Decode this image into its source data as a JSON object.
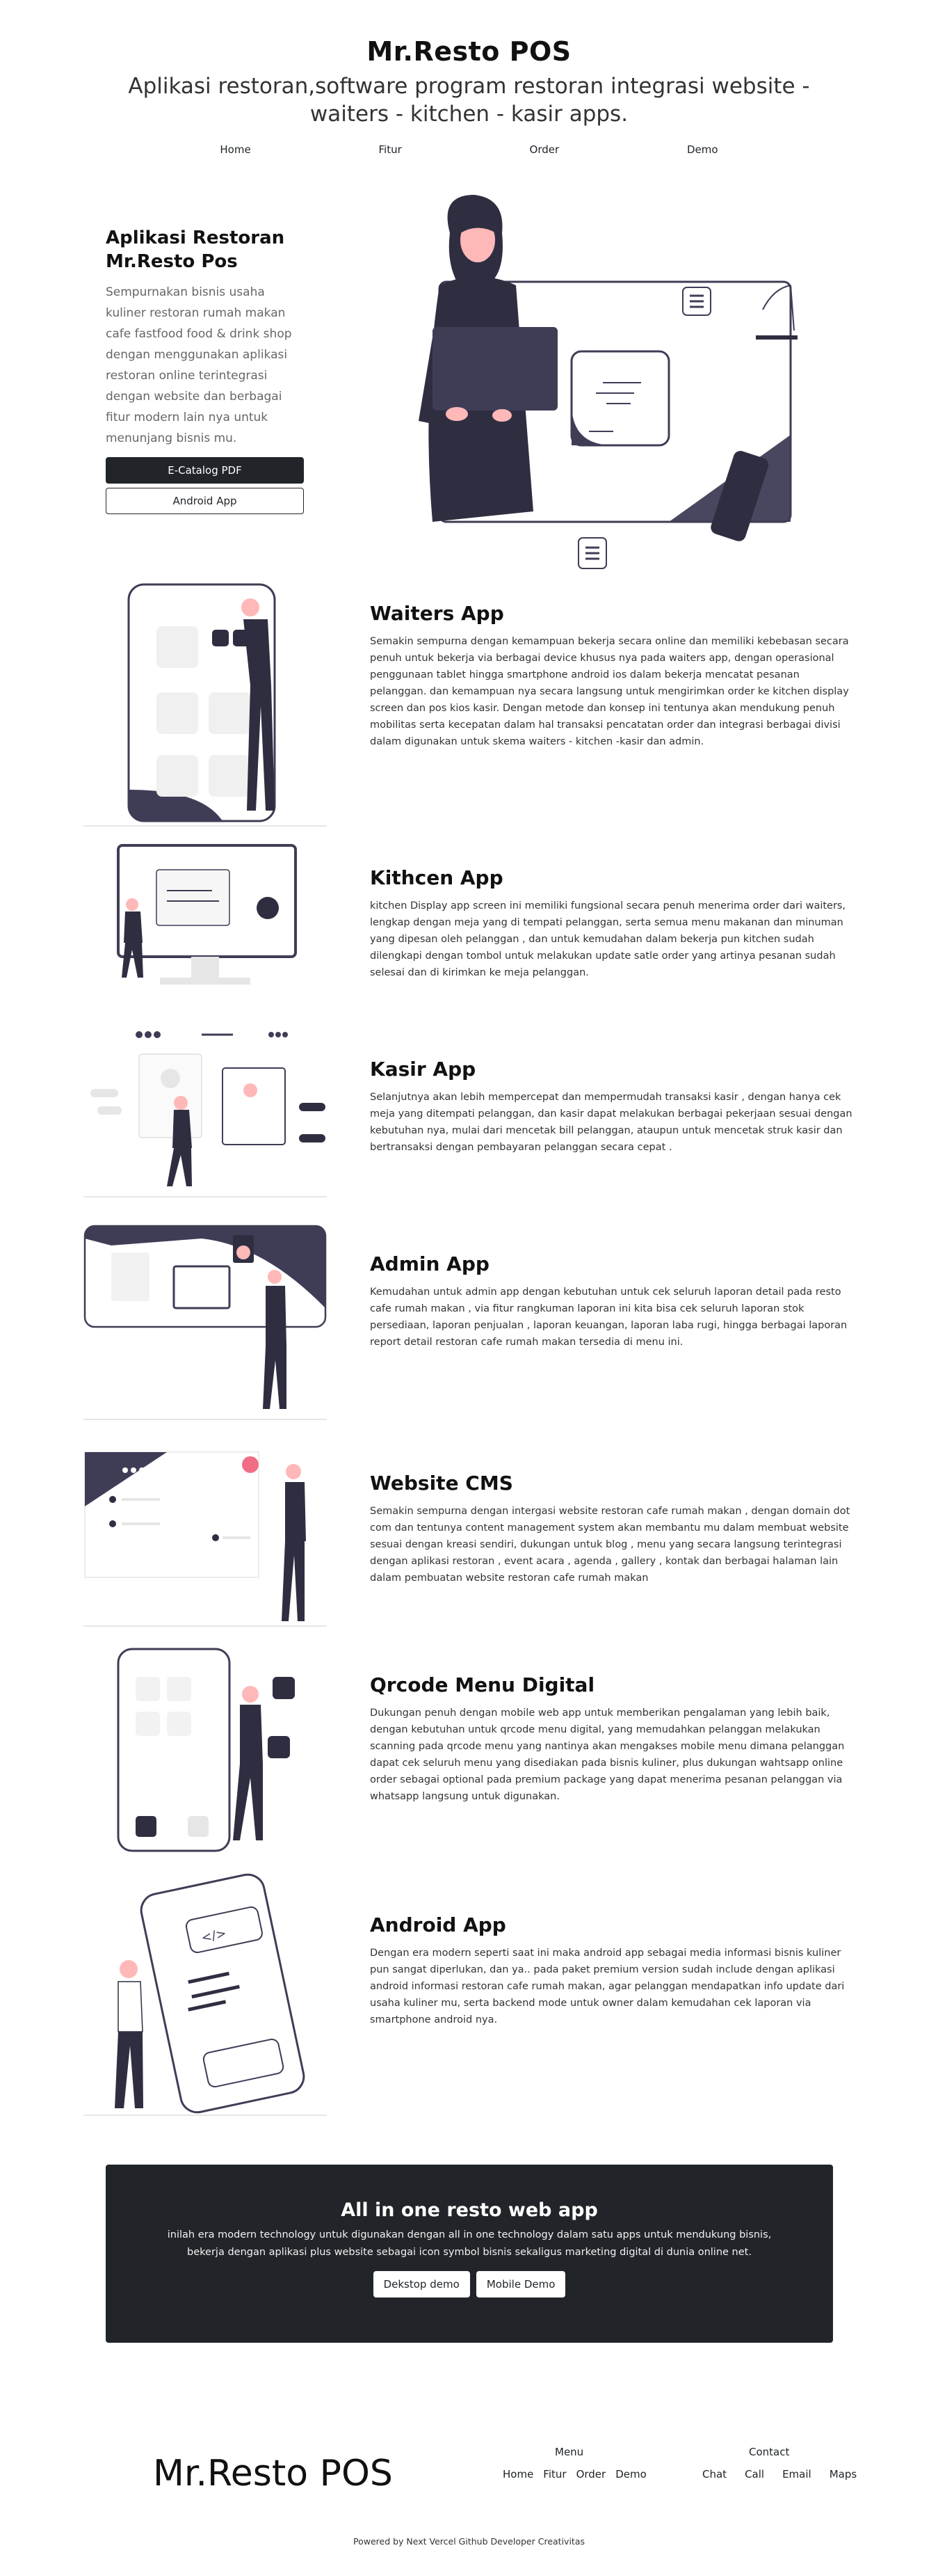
{
  "header": {
    "brand": "Mr.Resto POS",
    "subtitle": "Aplikasi restoran,software program restoran integrasi website - waiters - kitchen - kasir apps."
  },
  "nav": [
    "Home",
    "Fitur",
    "Order",
    "Demo"
  ],
  "hero": {
    "title": "Aplikasi Restoran Mr.Resto Pos",
    "description": "Sempurnakan bisnis usaha kuliner restoran rumah makan cafe fastfood food & drink shop dengan menggunakan aplikasi restoran online terintegrasi dengan website dan berbagai fitur modern lain nya untuk menunjang bisnis mu.",
    "catalog_button": "E-Catalog PDF",
    "android_button": "Android App"
  },
  "features": [
    {
      "title": "Waiters App",
      "text": "Semakin sempurna dengan kemampuan bekerja secara online dan memiliki kebebasan secara penuh untuk bekerja via berbagai device khusus nya pada waiters app, dengan operasional penggunaan tablet hingga smartphone android ios dalam bekerja mencatat pesanan pelanggan. dan kemampuan nya secara langsung untuk mengirimkan order ke kitchen display screen dan pos kios kasir. Dengan metode dan konsep ini tentunya akan mendukung penuh mobilitas serta kecepatan dalam hal transaksi pencatatan order dan integrasi berbagai divisi dalam digunakan untuk skema waiters - kitchen -kasir dan admin."
    },
    {
      "title": "Kithcen App",
      "text": "kitchen Display app screen ini memiliki fungsional secara penuh menerima order dari waiters, lengkap dengan meja yang di tempati pelanggan, serta semua menu makanan dan minuman yang dipesan oleh pelanggan , dan untuk kemudahan dalam bekerja pun kitchen sudah dilengkapi dengan tombol untuk melakukan update satle order yang artinya pesanan sudah selesai dan di kirimkan ke meja pelanggan."
    },
    {
      "title": "Kasir App",
      "text": "Selanjutnya akan lebih mempercepat dan mempermudah transaksi kasir , dengan hanya cek meja yang ditempati pelanggan, dan kasir dapat melakukan berbagai pekerjaan sesuai dengan kebutuhan nya, mulai dari mencetak bill pelanggan, ataupun untuk mencetak struk kasir dan bertransaksi dengan pembayaran pelanggan secara cepat ."
    },
    {
      "title": "Admin App",
      "text": "Kemudahan untuk admin app dengan kebutuhan untuk cek seluruh laporan detail pada resto cafe rumah makan , via fitur rangkuman laporan ini kita bisa cek seluruh laporan stok persediaan, laporan penjualan , laporan keuangan, laporan laba rugi, hingga berbagai laporan report detail restoran cafe rumah makan tersedia di menu ini."
    },
    {
      "title": "Website CMS",
      "text": "Semakin sempurna dengan intergasi website restoran cafe rumah makan , dengan domain dot com dan tentunya content management system akan membantu mu dalam membuat website sesuai dengan kreasi sendiri, dukungan untuk blog , menu yang secara langsung terintegrasi dengan aplikasi restoran , event acara , agenda , gallery , kontak dan berbagai halaman lain dalam pembuatan website restoran cafe rumah makan"
    },
    {
      "title": "Qrcode Menu Digital",
      "text": "Dukungan penuh dengan mobile web app untuk memberikan pengalaman yang lebih baik, dengan kebutuhan untuk qrcode menu digital, yang memudahkan pelanggan melakukan scanning pada qrcode menu yang nantinya akan mengakses mobile menu dimana pelanggan dapat cek seluruh menu yang disediakan pada bisnis kuliner, plus dukungan wahtsapp online order sebagai optional pada premium package yang dapat menerima pesanan pelanggan via whatsapp langsung untuk digunakan."
    },
    {
      "title": "Android App",
      "text": "Dengan era modern seperti saat ini maka android app sebagai media informasi bisnis kuliner pun sangat diperlukan, dan ya.. pada paket premium version sudah include dengan aplikasi android informasi restoran cafe rumah makan, agar pelanggan mendapatkan info update dari usaha kuliner mu, serta backend mode untuk owner dalam kemudahan cek laporan via smartphone android nya."
    }
  ],
  "cta": {
    "title": "All in one resto web app",
    "text": "inilah era modern technology untuk digunakan dengan all in one technology dalam satu apps untuk mendukung bisnis, bekerja dengan aplikasi plus website sebagai icon symbol bisnis sekaligus marketing digital di dunia online net.",
    "desktop_button": "Dekstop demo",
    "mobile_button": "Mobile Demo"
  },
  "footer": {
    "brand": "Mr.Resto POS",
    "menu_title": "Menu",
    "menu_links": [
      "Home",
      "Fitur",
      "Order",
      "Demo"
    ],
    "contact_title": "Contact",
    "contact_links": [
      "Chat",
      "Call",
      "Email",
      "Maps"
    ],
    "powered": "Powered by Next Vercel Github Developer Creativitas"
  },
  "colors": {
    "dark": "#212529",
    "illustration": "#3f3d56",
    "accent": "#f06e85",
    "skin": "#ffb8b8"
  }
}
